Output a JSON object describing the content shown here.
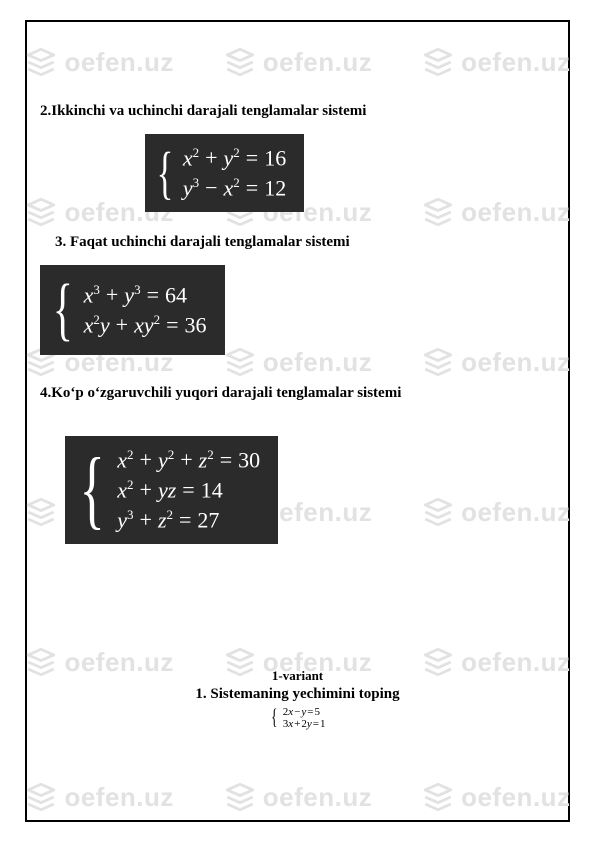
{
  "watermark": {
    "text": "oefen.uz"
  },
  "sections": {
    "s2": {
      "heading": "2.Ikkinchi va uchinchi darajali tenglamalar sistemi"
    },
    "s3": {
      "heading": "3. Faqat uchinchi darajali tenglamalar sistemi"
    },
    "s4": {
      "heading": "4.Koʻp oʻzgaruvchili yuqori darajali tenglamalar sistemi"
    }
  },
  "equations": {
    "sys2": {
      "line1": {
        "lhs_a": "x",
        "exp_a": "2",
        "op1": "+",
        "lhs_b": "y",
        "exp_b": "2",
        "eq": "=",
        "rhs": "16"
      },
      "line2": {
        "lhs_a": "y",
        "exp_a": "3",
        "op1": "−",
        "lhs_b": "x",
        "exp_b": "2",
        "eq": "=",
        "rhs": "12"
      }
    },
    "sys3": {
      "line1": {
        "lhs_a": "x",
        "exp_a": "3",
        "op1": "+",
        "lhs_b": "y",
        "exp_b": "3",
        "eq": "=",
        "rhs": "64"
      },
      "line2": {
        "t1a": "x",
        "t1ae": "2",
        "t1b": "y",
        "op1": "+",
        "t2a": "x",
        "t2b": "y",
        "t2be": "2",
        "eq": "=",
        "rhs": "36"
      }
    },
    "sys4": {
      "line1": {
        "a": "x",
        "ae": "2",
        "op1": "+",
        "b": "y",
        "be": "2",
        "op2": "+",
        "c": "z",
        "ce": "2",
        "eq": "=",
        "rhs": "30"
      },
      "line2": {
        "a": "x",
        "ae": "2",
        "op1": "+",
        "b": "y",
        "c": "z",
        "eq": "=",
        "rhs": "14"
      },
      "line3": {
        "a": "y",
        "ae": "3",
        "op1": "+",
        "b": "z",
        "be": "2",
        "eq": "=",
        "rhs": "27"
      }
    }
  },
  "variant": {
    "title": "1-variant",
    "q1": "1. Sistemaning yechimini toping",
    "sys": {
      "line1": {
        "c1": "2",
        "v1": "x",
        "op": "−",
        "v2": "y",
        "eq": "=",
        "rhs": "5"
      },
      "line2": {
        "c1": "3",
        "v1": "x",
        "op": "+",
        "c2": "2",
        "v2": "y",
        "eq": "=",
        "rhs": "1"
      }
    }
  }
}
